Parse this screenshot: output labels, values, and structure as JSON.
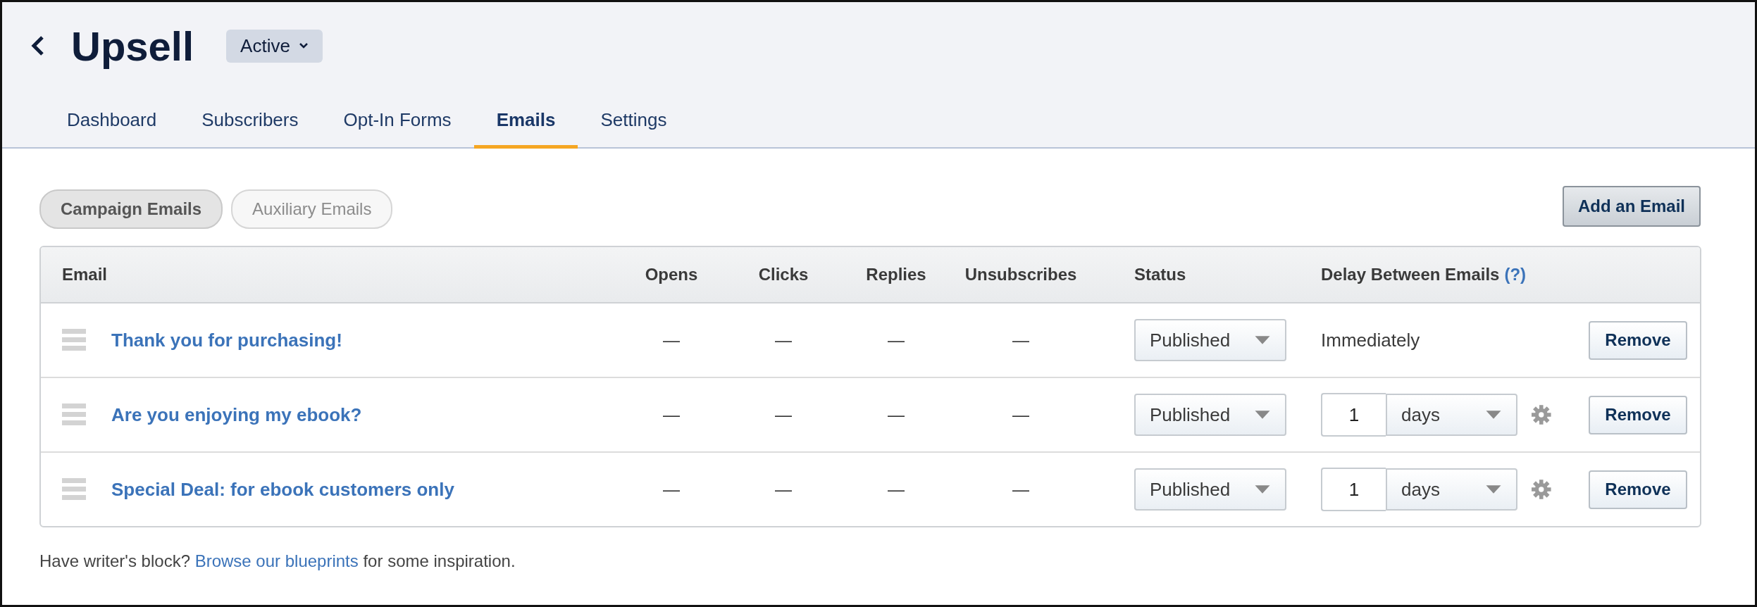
{
  "header": {
    "title": "Upsell",
    "status": "Active"
  },
  "tabs": [
    {
      "label": "Dashboard",
      "selected": false
    },
    {
      "label": "Subscribers",
      "selected": false
    },
    {
      "label": "Opt-In Forms",
      "selected": false
    },
    {
      "label": "Emails",
      "selected": true
    },
    {
      "label": "Settings",
      "selected": false
    }
  ],
  "segments": [
    {
      "label": "Campaign Emails",
      "selected": true
    },
    {
      "label": "Auxiliary Emails",
      "selected": false
    }
  ],
  "add_button": "Add an Email",
  "table": {
    "columns": [
      "Email",
      "Opens",
      "Clicks",
      "Replies",
      "Unsubscribes",
      "Status",
      "Delay Between Emails"
    ],
    "help": "(?)",
    "rows": [
      {
        "email": "Thank you for purchasing!",
        "opens": "—",
        "clicks": "—",
        "replies": "—",
        "unsubscribes": "—",
        "status": "Published",
        "delay": {
          "kind": "text",
          "text": "Immediately"
        },
        "remove": "Remove"
      },
      {
        "email": "Are you enjoying my ebook?",
        "opens": "—",
        "clicks": "—",
        "replies": "—",
        "unsubscribes": "—",
        "status": "Published",
        "delay": {
          "kind": "input",
          "value": "1",
          "unit": "days"
        },
        "remove": "Remove"
      },
      {
        "email": "Special Deal: for ebook customers only",
        "opens": "—",
        "clicks": "—",
        "replies": "—",
        "unsubscribes": "—",
        "status": "Published",
        "delay": {
          "kind": "input",
          "value": "1",
          "unit": "days"
        },
        "remove": "Remove"
      }
    ]
  },
  "footer": {
    "before": "Have writer's block? ",
    "link": "Browse our blueprints",
    "after": " for some inspiration."
  }
}
